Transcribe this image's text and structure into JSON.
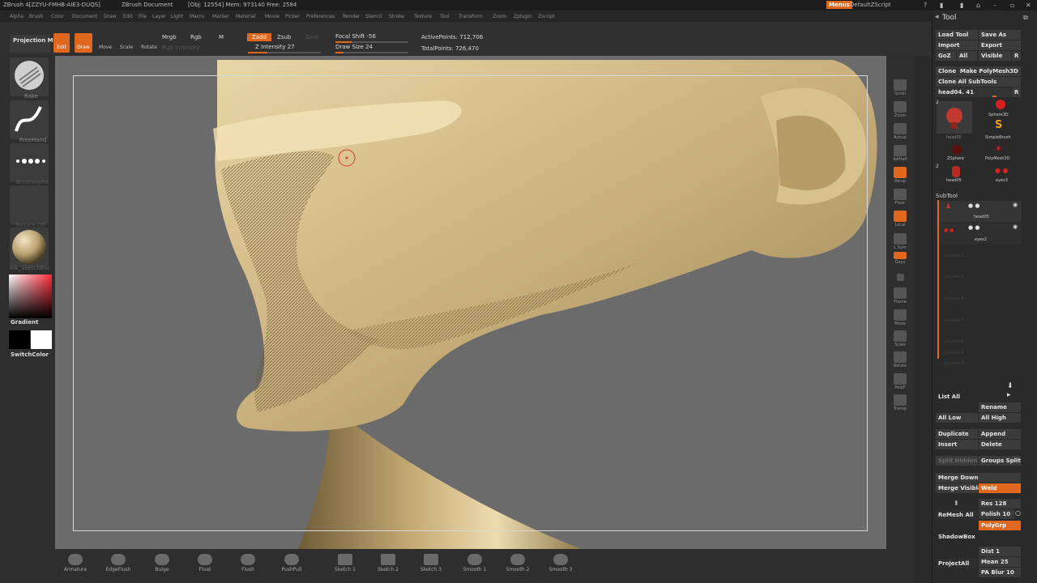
{
  "titlebar": {
    "app": "ZBrush 4[ZZYU-FMHB-AIE3-DUQS]",
    "doc": "ZBrush Document",
    "stats": "[Obj: 12554] Mem: 973140 Free: 2584",
    "menus_btn": "Menus",
    "script": "DefaultZScript"
  },
  "menubar": [
    "Alpha",
    "Brush",
    "Color",
    "Document",
    "Draw",
    "Edit",
    "File",
    "Layer",
    "Light",
    "Macro",
    "Marker",
    "Material",
    "Movie",
    "Picker",
    "Preferences",
    "Render",
    "Stencil",
    "Stroke",
    "Texture",
    "Tool",
    "Transform",
    "Zoom",
    "Zplugin",
    "Zscript"
  ],
  "topshelf": {
    "projection_master": "Projection Master",
    "edit": "Edit",
    "draw": "Draw",
    "move": "Move",
    "scale": "Scale",
    "rotate": "Rotate",
    "mrgb": "Mrgb",
    "rgb": "Rgb",
    "m": "M",
    "rgb_intensity": "Rgb Intensity",
    "zadd": "Zadd",
    "zsub": "Zsub",
    "zcut": "Zcut",
    "z_intensity": "Z Intensity 27",
    "focal_shift": "Focal Shift -56",
    "draw_size": "Draw Size 24",
    "active_points": "ActivePoints: 712,706",
    "total_points": "TotalPoints: 726,470"
  },
  "leftshelf": {
    "brush_label": "Rake",
    "stroke_label": "FreeHand",
    "alpha_label": "BrushAlpha",
    "texture_label": "Texture Off",
    "material_label": "Ink_SketchBlu",
    "gradient_label": "Gradient",
    "switch_label": "SwitchColor"
  },
  "rightshelf": [
    "Scroll",
    "Zoom",
    "Actual",
    "AAHalf",
    "Persp",
    "Floor",
    "Local",
    "L.Sym",
    "Gxyz",
    "",
    "Frame",
    "Move",
    "Scale",
    "Rotate",
    "PolyF",
    "Transp"
  ],
  "bottomshelf": [
    "Armature",
    "EdgeFlush",
    "Bulge",
    "Float",
    "Flush",
    "PushPull",
    "Sketch 1",
    "Sketch 2",
    "Sketch 3",
    "Smooth 1",
    "Smooth 2",
    "Smooth 3"
  ],
  "toolpanel": {
    "title": "Tool",
    "load_tool": "Load Tool",
    "save_as": "Save As",
    "import": "Import",
    "export": "Export",
    "goz": "GoZ",
    "all": "All",
    "visible": "Visible",
    "r": "R",
    "clone": "Clone",
    "make_polymesh": "Make PolyMesh3D",
    "clone_all": "Clone All SubTools",
    "current_tool": "head04. 41",
    "tools": [
      "head05",
      "Sphere3D",
      "SimpleBrush",
      "ZSphere",
      "PolyMesh3D",
      "head05",
      "eyes3"
    ],
    "tool_counts": [
      "2",
      "2"
    ],
    "subtool_title": "SubTool",
    "subtools": [
      "head05",
      "eyes2"
    ],
    "empty_slots": [
      "Unused 2",
      "Unused 3",
      "Unused 4",
      "Unused 5",
      "Unused 6",
      "Unused 7",
      "Unused 8"
    ],
    "list_all": "List All",
    "rename": "Rename",
    "all_low": "All Low",
    "all_high": "All High",
    "duplicate": "Duplicate",
    "append": "Append",
    "insert": "Insert",
    "delete": "Delete",
    "split_hidden": "Split Hidden",
    "groups_split": "Groups Split",
    "merge_down": "Merge Down",
    "merge_visible": "Merge Visible",
    "weld": "Weld",
    "remesh_all": "ReMesh All",
    "res": "Res 128",
    "polish": "Polish 10",
    "polygrp": "PolyGrp",
    "shadowbox": "ShadowBox",
    "project_all": "ProjectAll",
    "dist": "Dist 1",
    "mean": "Mean 25",
    "pa_blur": "PA Blur 10"
  },
  "colors": {
    "accent": "#e0671e",
    "skin": "#cdb583",
    "background": "#6b6b6b"
  }
}
